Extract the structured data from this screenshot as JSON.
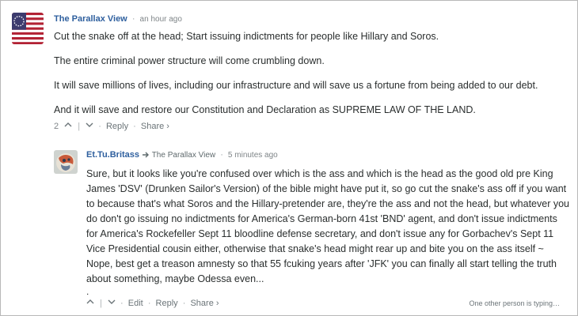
{
  "comments": [
    {
      "author": "The Parallax View",
      "time": "an hour ago",
      "paragraphs": [
        "Cut the snake off at the head; Start issuing indictments for people like Hillary and Soros.",
        "The entire criminal power structure will come crumbling down.",
        "It will save millions of lives, including our infrastructure and will save us a fortune from being added to our debt.",
        "And it will save and restore our Constitution and Declaration as SUPREME LAW OF THE LAND."
      ],
      "votes": "2",
      "actions": {
        "reply": "Reply",
        "share": "Share ›"
      }
    },
    {
      "author": "Et.Tu.Britass",
      "reply_to": "The Parallax View",
      "time": "5 minutes ago",
      "text": "Sure, but it looks like you're confused over which is the ass and which is the head as the good old pre King James 'DSV' (Drunken Sailor's Version) of the bible might have put it, so go cut the snake's ass off if you want to because that's what Soros and the Hillary-pretender are, they're the ass and not the head, but whatever you do don't go issuing no indictments for America's German-born 41st 'BND' agent, and don't issue indictments for America's Rockefeller Sept 11 bloodline defense secretary, and don't issue any for Gorbachev's Sept 11 Vice Presidential cousin either, otherwise that snake's head might rear up and bite you on the ass itself ~ Nope, best get a treason amnesty so that 55 fcuking years after 'JFK' you can finally all start telling the truth about something, maybe Odessa even...",
      "trailing": ".",
      "actions": {
        "edit": "Edit",
        "reply": "Reply",
        "share": "Share ›"
      }
    }
  ],
  "typing_indicator": "One other person is typing…",
  "icons": {
    "upvote": "chevron-up-icon",
    "downvote": "chevron-down-icon",
    "reply_arrow": "reply-arrow-icon"
  },
  "colors": {
    "author": "#2e5f9e",
    "text": "#2a2e2e",
    "meta": "#7f8588"
  }
}
